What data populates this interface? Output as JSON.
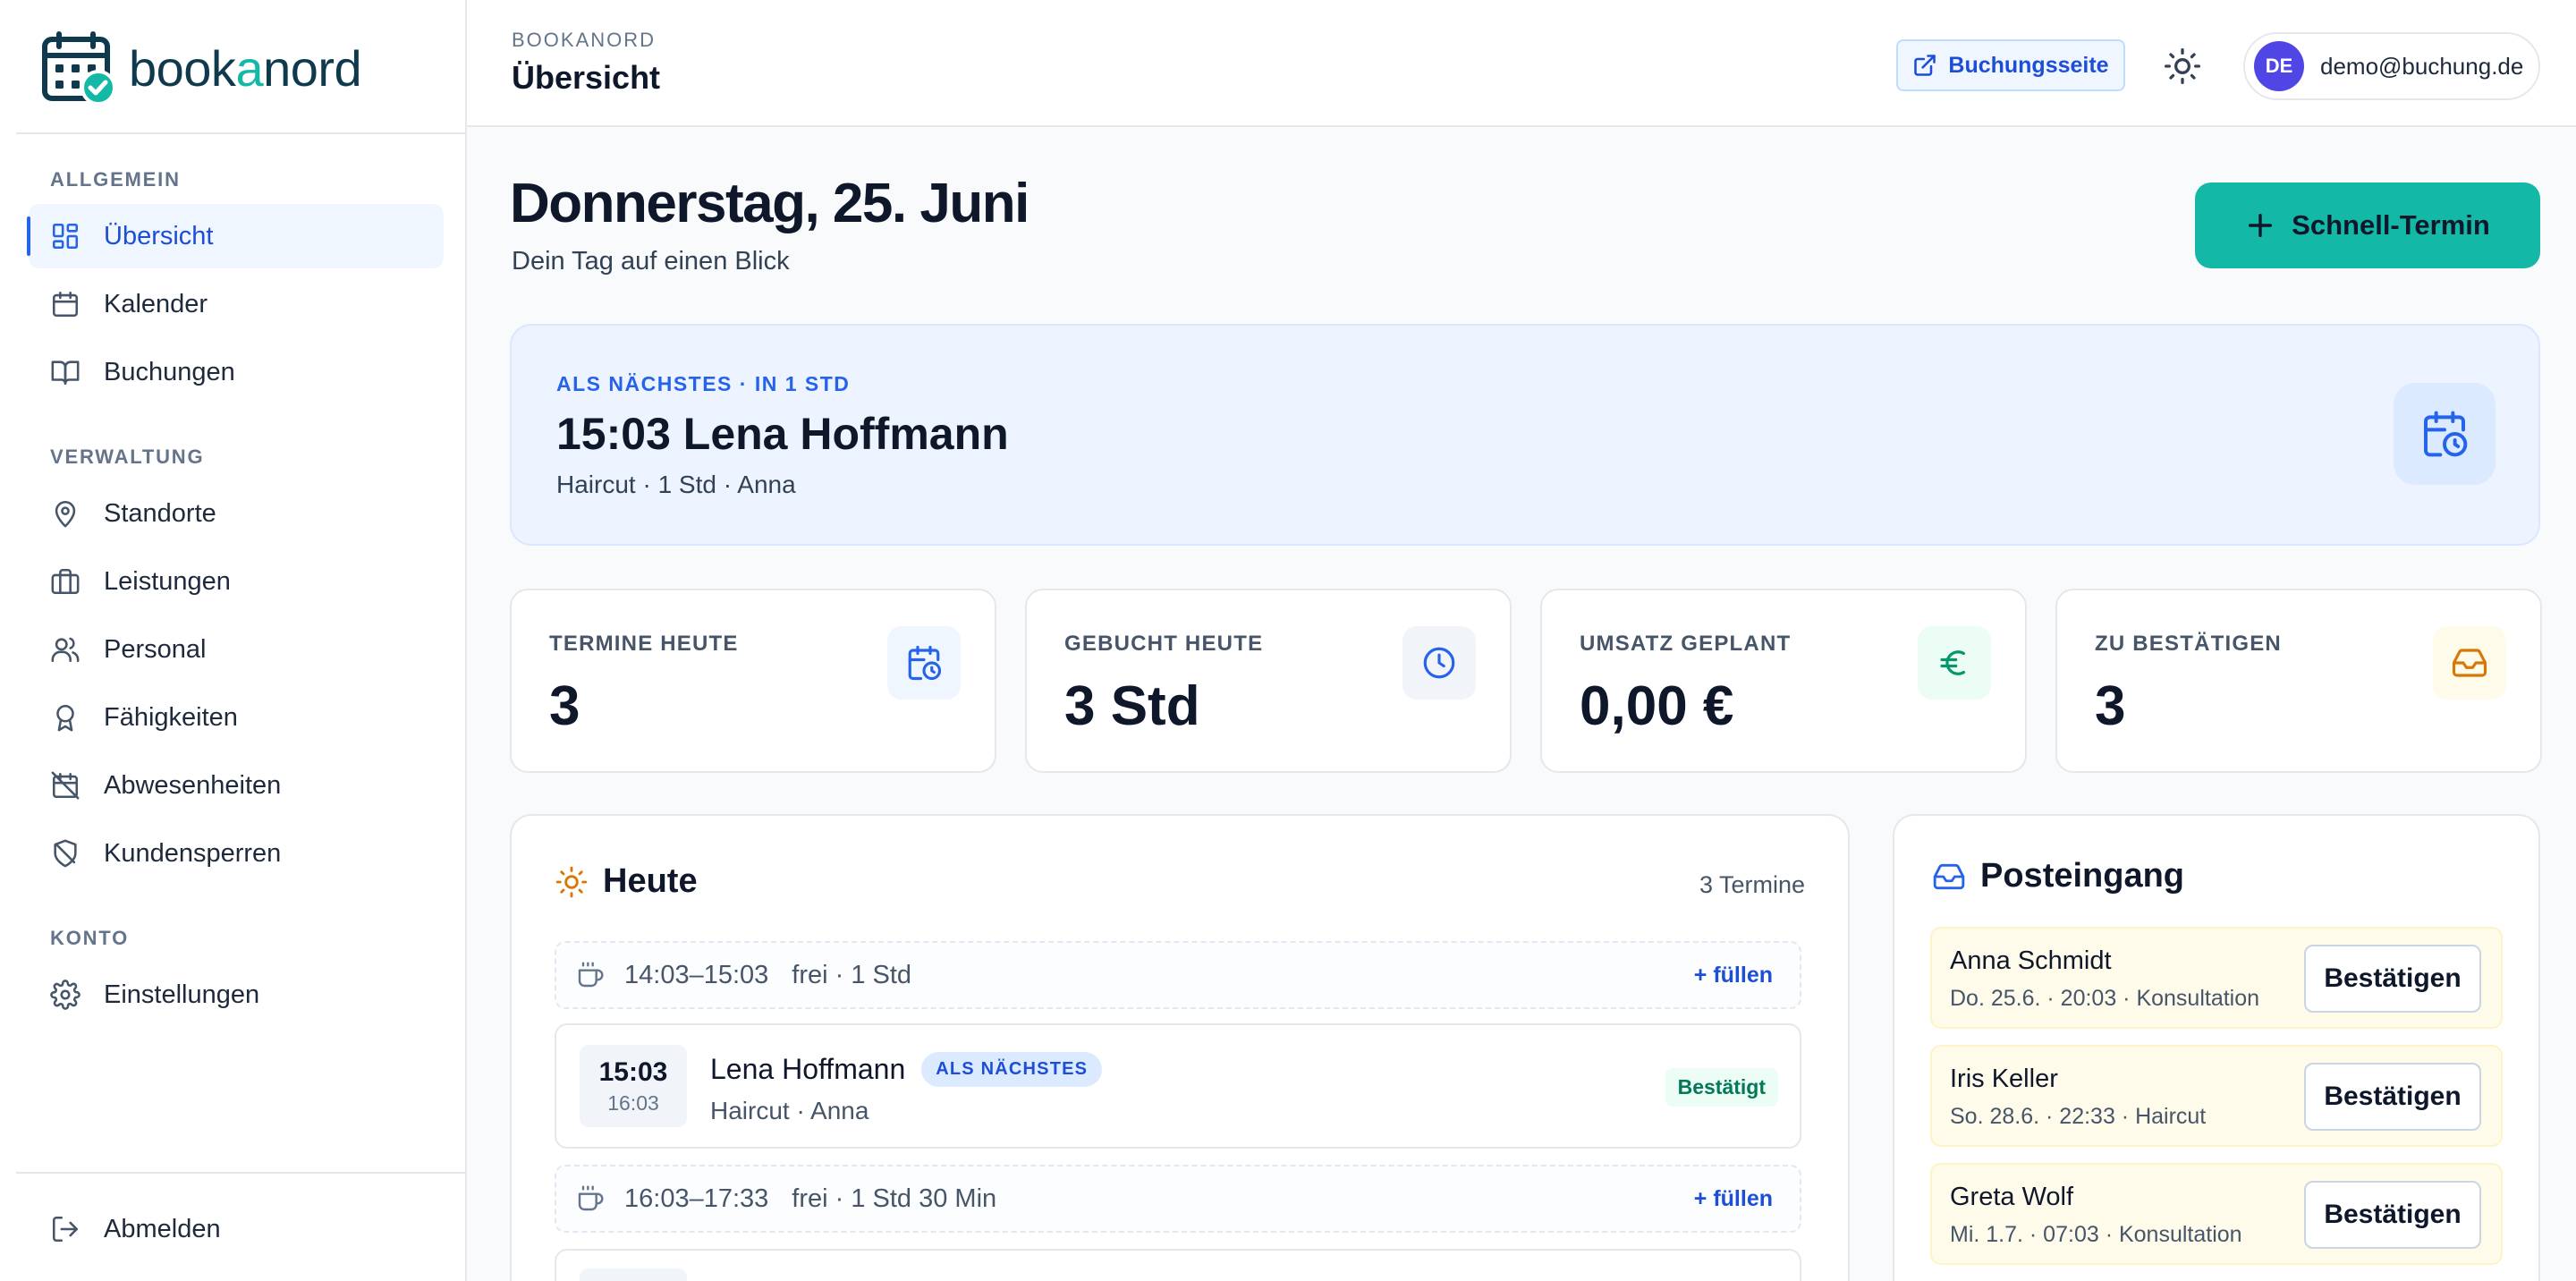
{
  "brand": {
    "name_pre": "book",
    "name_accent": "a",
    "name_post": "nord"
  },
  "sidebar": {
    "sections": [
      {
        "label": "ALLGEMEIN"
      },
      {
        "label": "VERWALTUNG"
      },
      {
        "label": "KONTO"
      }
    ],
    "items": [
      {
        "label": "Übersicht",
        "icon": "dashboard-icon",
        "active": true
      },
      {
        "label": "Kalender",
        "icon": "calendar-icon"
      },
      {
        "label": "Buchungen",
        "icon": "book-icon"
      },
      {
        "label": "Standorte",
        "icon": "map-pin-icon"
      },
      {
        "label": "Leistungen",
        "icon": "briefcase-icon"
      },
      {
        "label": "Personal",
        "icon": "users-icon"
      },
      {
        "label": "Fähigkeiten",
        "icon": "award-icon"
      },
      {
        "label": "Abwesenheiten",
        "icon": "calendar-off-icon"
      },
      {
        "label": "Kundensperren",
        "icon": "shield-off-icon"
      },
      {
        "label": "Einstellungen",
        "icon": "gear-icon"
      }
    ],
    "logout": "Abmelden"
  },
  "header": {
    "breadcrumb": "BOOKANORD",
    "title": "Übersicht",
    "booking_page_label": "Buchungsseite",
    "user_initials": "DE",
    "user_email": "demo@buchung.de"
  },
  "page": {
    "date_heading": "Donnerstag, 25. Juni",
    "subtitle": "Dein Tag auf einen Blick",
    "quick_button": "Schnell-Termin"
  },
  "next_appointment": {
    "kicker": "ALS NÄCHSTES · IN 1 STD",
    "title": "15:03 Lena Hoffmann",
    "details": "Haircut · 1 Std · Anna"
  },
  "stats": [
    {
      "label": "TERMINE HEUTE",
      "value": "3",
      "icon": "calendar-clock-icon",
      "color": "#2563eb"
    },
    {
      "label": "GEBUCHT HEUTE",
      "value": "3 Std",
      "icon": "clock-icon",
      "color": "#2563eb"
    },
    {
      "label": "UMSATZ GEPLANT",
      "value": "0,00 €",
      "icon": "euro-icon",
      "color": "#059669"
    },
    {
      "label": "ZU BESTÄTIGEN",
      "value": "3",
      "icon": "inbox-icon",
      "color": "#d97706"
    }
  ],
  "today": {
    "title": "Heute",
    "count": "3 Termine",
    "free_slots": [
      {
        "time": "14:03–15:03",
        "info": "frei · 1 Std",
        "action": "+ füllen"
      },
      {
        "time": "16:03–17:33",
        "info": "frei · 1 Std 30 Min",
        "action": "+ füllen"
      }
    ],
    "appointment": {
      "start": "15:03",
      "end": "16:03",
      "name": "Lena Hoffmann",
      "badge": "ALS NÄCHSTES",
      "details": "Haircut · Anna",
      "status": "Bestätigt"
    }
  },
  "inbox": {
    "title": "Posteingang",
    "items": [
      {
        "name": "Anna Schmidt",
        "details": "Do. 25.6. · 20:03 · Konsultation",
        "action": "Bestätigen"
      },
      {
        "name": "Iris Keller",
        "details": "So. 28.6. · 22:33 · Haircut",
        "action": "Bestätigen"
      },
      {
        "name": "Greta Wolf",
        "details": "Mi. 1.7. · 07:03 · Konsultation",
        "action": "Bestätigen"
      }
    ]
  },
  "colors": {
    "accent": "#14b8a6",
    "primary": "#2563eb",
    "brand_dark": "#0f3a4d"
  }
}
